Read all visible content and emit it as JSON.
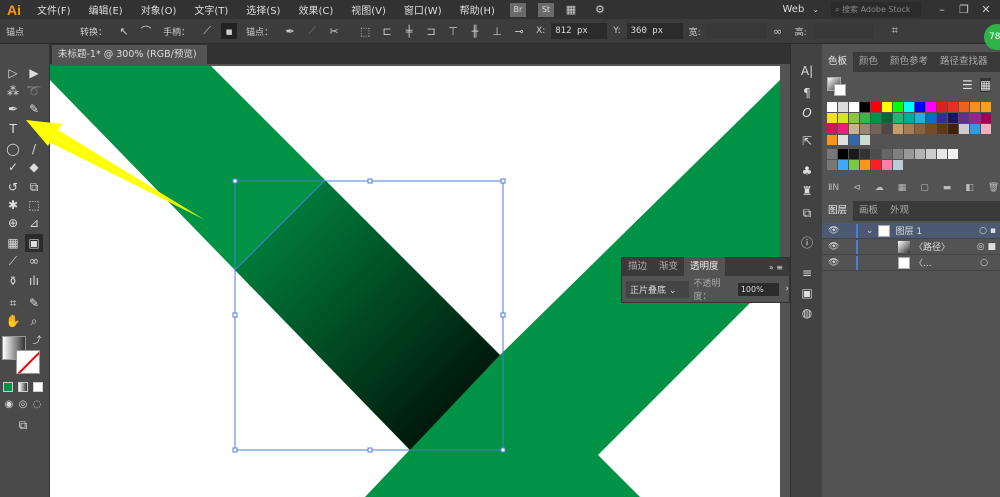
{
  "app": {
    "logo": "Ai",
    "workspace": "Web",
    "search_placeholder": "搜索 Adobe Stock",
    "bridge": "Br",
    "stock": "St"
  },
  "menu": [
    "文件(F)",
    "编辑(E)",
    "对象(O)",
    "文字(T)",
    "选择(S)",
    "效果(C)",
    "视图(V)",
    "窗口(W)",
    "帮助(H)"
  ],
  "control": {
    "context": "锚点",
    "convert": "转换：",
    "handles": "手柄：",
    "anchors": "锚点：",
    "x_label": "X:",
    "x_value": "812 px",
    "y_label": "Y:",
    "y_value": "360 px",
    "w_label": "宽:",
    "h_label": "高:"
  },
  "document": {
    "tab": "未标题-1* @ 300% (RGB/预览)",
    "close": "×"
  },
  "swatches_panel": {
    "tabs": [
      "色板",
      "颜色",
      "颜色参考",
      "路径查找器"
    ],
    "rows": [
      [
        "#ffffff",
        "#dddddd",
        "#ffffff",
        "#000000",
        "#ff0000",
        "#ffff00",
        "#00ff00",
        "#00ffff",
        "#0000ff",
        "#ff00ff",
        "#e02020",
        "#e83020",
        "#f06020",
        "#f59020",
        "#f5a020"
      ],
      [
        "#f5e020",
        "#d8e030",
        "#8cc63f",
        "#39b54a",
        "#009245",
        "#006837",
        "#22b573",
        "#00a99d",
        "#29abe2",
        "#0071bc",
        "#2e3192",
        "#1b1464",
        "#662d91",
        "#93278f",
        "#9e005d"
      ],
      [
        "#d4145a",
        "#ed1e79",
        "#c7b299",
        "#998675",
        "#736357",
        "#534741",
        "#c69c6d",
        "#a67c52",
        "#8c6239",
        "#754c24",
        "#603813",
        "#42210b",
        "#cccccc",
        "#3399dd",
        "#f0b0c0"
      ],
      [
        "#f7931e",
        "#e0e0e0",
        "#3366aa",
        "#ccddcc"
      ],
      [
        "#000000",
        "#1a1a1a",
        "#333333",
        "#4d4d4d",
        "#666666",
        "#808080",
        "#999999",
        "#b3b3b3",
        "#cccccc",
        "#e6e6e6",
        "#f2f2f2"
      ],
      [
        "#3fa9f5",
        "#7ac943",
        "#ff931e",
        "#ff1d25",
        "#ff7bac",
        "#bdccd4"
      ]
    ]
  },
  "layers_panel": {
    "tabs": [
      "图层",
      "画板",
      "外观"
    ],
    "items": [
      {
        "name": "图层 1"
      },
      {
        "name": "〈路径〉"
      },
      {
        "name": "〈..."
      }
    ]
  },
  "transparency_panel": {
    "tabs": [
      "描边",
      "渐变",
      "透明度"
    ],
    "blend_mode": "正片叠底",
    "opacity_label": "不透明度：",
    "opacity_value": "100%"
  },
  "badge": "78",
  "colors": {
    "green": "#009245",
    "arrow": "#ffff00",
    "selection": "#4a7fd8"
  }
}
